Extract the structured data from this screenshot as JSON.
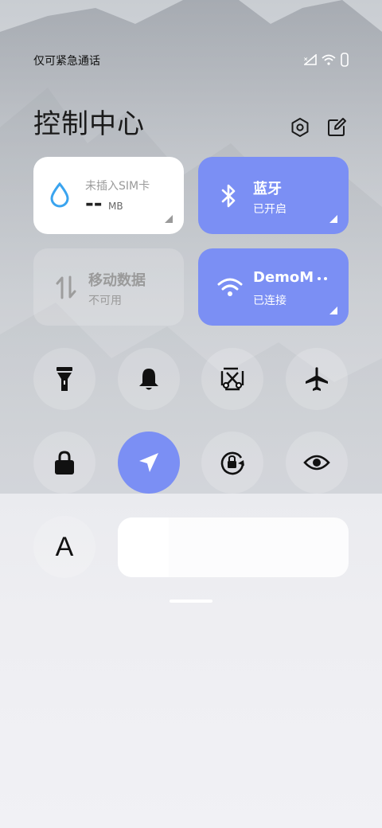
{
  "status_bar": {
    "carrier_text": "仅可紧急通话",
    "icons": [
      "signal-icon",
      "wifi-icon",
      "battery-icon"
    ]
  },
  "header": {
    "title": "控制中心",
    "settings_icon": "settings-icon",
    "edit_icon": "edit-icon"
  },
  "tiles": {
    "data_usage": {
      "label": "未插入SIM卡",
      "value": "--",
      "unit": "MB",
      "icon": "water-drop-icon"
    },
    "bluetooth": {
      "label": "蓝牙",
      "status": "已开启",
      "icon": "bluetooth-icon"
    },
    "mobile_data": {
      "label": "移动数据",
      "status": "不可用",
      "icon": "data-arrows-icon"
    },
    "wifi": {
      "label": "DemoM",
      "status": "已连接",
      "icon": "wifi-icon"
    }
  },
  "toggles_row1": [
    {
      "name": "flashlight",
      "icon": "flashlight-icon"
    },
    {
      "name": "sound",
      "icon": "bell-icon"
    },
    {
      "name": "screenshot",
      "icon": "scissors-icon"
    },
    {
      "name": "airplane-mode",
      "icon": "airplane-icon"
    }
  ],
  "toggles_row2": [
    {
      "name": "lock-screen",
      "icon": "lock-icon"
    },
    {
      "name": "location",
      "icon": "location-arrow-icon",
      "active": true
    },
    {
      "name": "rotation-lock",
      "icon": "rotation-lock-icon"
    },
    {
      "name": "reading-mode",
      "icon": "eye-icon"
    }
  ],
  "font_toggle": {
    "glyph": "A"
  },
  "brightness": {
    "level": 0.22
  },
  "colors": {
    "accent": "#7b8ff4",
    "data_icon": "#3aa4ef"
  }
}
